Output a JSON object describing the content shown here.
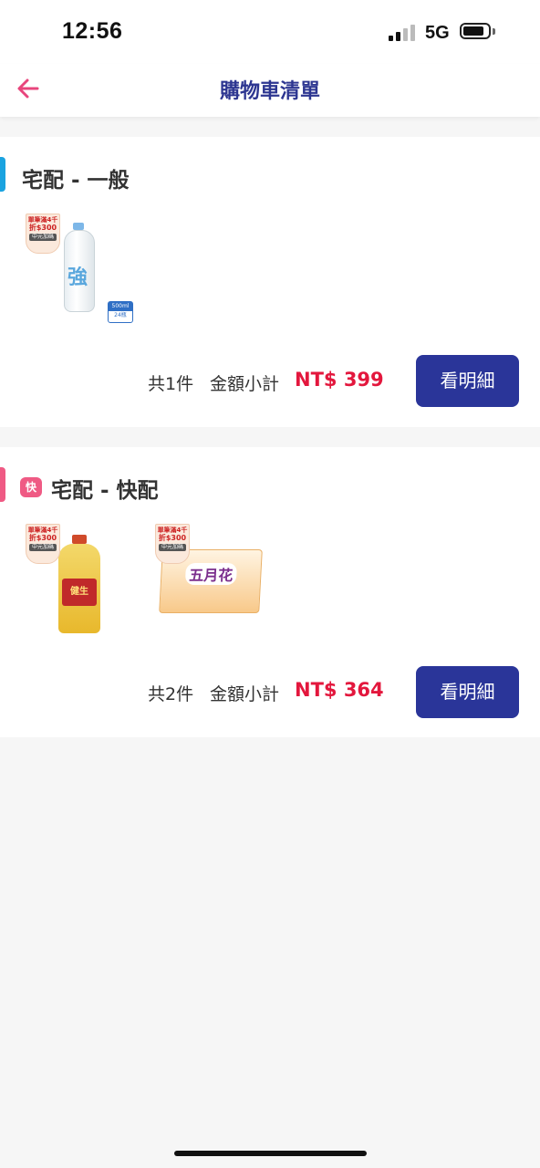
{
  "status_bar": {
    "time": "12:56",
    "network": "5G"
  },
  "header": {
    "title": "購物車清單",
    "back_icon": "arrow-left-icon"
  },
  "colors": {
    "primary": "#2a3599",
    "accent_red": "#e3173d",
    "back_arrow": "#e8457c",
    "marker_general": "#1aa3e0",
    "marker_express": "#ef5a84"
  },
  "carts": [
    {
      "title": "宅配 - 一般",
      "products": [
        {
          "name": "sparkling-water-bottle",
          "promo": {
            "line1": "單筆滿4千",
            "line2": "折$300",
            "line3": "中元加碼"
          },
          "size_label": "500ml",
          "pack_label": "24瓶",
          "bottle_char": "強"
        }
      ],
      "count_text": "共1件",
      "subtotal_label": "金額小計",
      "amount": "NT$ 399",
      "button_label": "看明細"
    },
    {
      "title": "宅配 - 快配",
      "badge": "快",
      "products": [
        {
          "name": "cooking-oil-bottle",
          "promo": {
            "line1": "單筆滿4千",
            "line2": "折$300",
            "line3": "中元加碼"
          },
          "label_text": "健生"
        },
        {
          "name": "tissue-pack",
          "promo": {
            "line1": "單筆滿4千",
            "line2": "折$300",
            "line3": "中元加碼"
          },
          "brand": "五月花"
        }
      ],
      "count_text": "共2件",
      "subtotal_label": "金額小計",
      "amount": "NT$ 364",
      "button_label": "看明細"
    }
  ]
}
